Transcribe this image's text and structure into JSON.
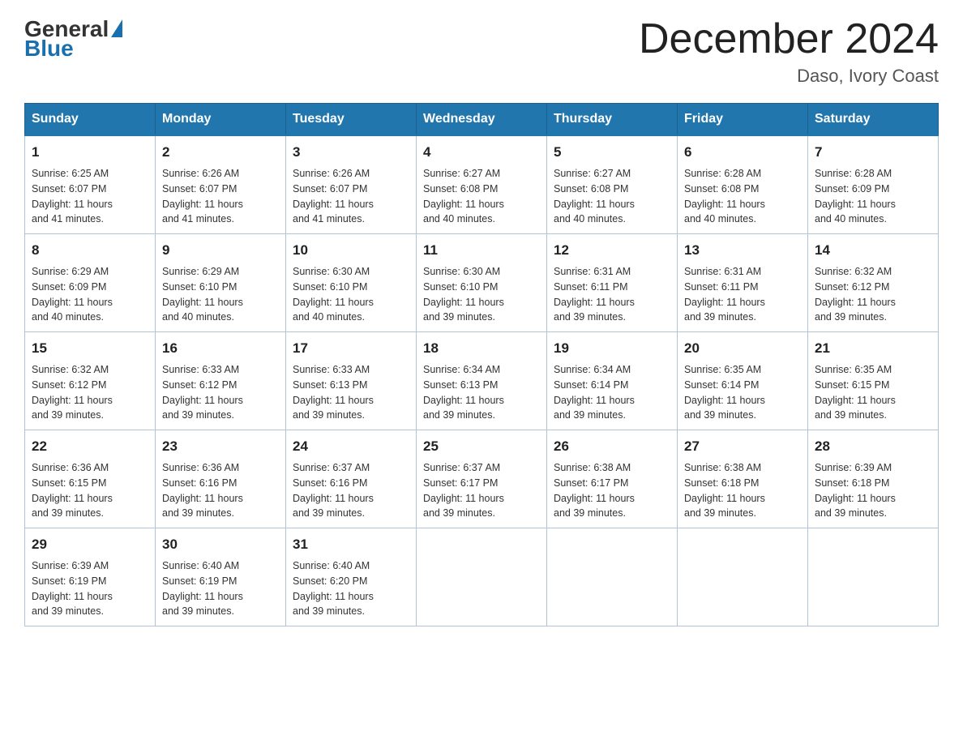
{
  "logo": {
    "general": "General",
    "blue": "Blue"
  },
  "title": "December 2024",
  "subtitle": "Daso, Ivory Coast",
  "days_header": [
    "Sunday",
    "Monday",
    "Tuesday",
    "Wednesday",
    "Thursday",
    "Friday",
    "Saturday"
  ],
  "weeks": [
    [
      {
        "day": "1",
        "sunrise": "6:25 AM",
        "sunset": "6:07 PM",
        "daylight": "11 hours and 41 minutes."
      },
      {
        "day": "2",
        "sunrise": "6:26 AM",
        "sunset": "6:07 PM",
        "daylight": "11 hours and 41 minutes."
      },
      {
        "day": "3",
        "sunrise": "6:26 AM",
        "sunset": "6:07 PM",
        "daylight": "11 hours and 41 minutes."
      },
      {
        "day": "4",
        "sunrise": "6:27 AM",
        "sunset": "6:08 PM",
        "daylight": "11 hours and 40 minutes."
      },
      {
        "day": "5",
        "sunrise": "6:27 AM",
        "sunset": "6:08 PM",
        "daylight": "11 hours and 40 minutes."
      },
      {
        "day": "6",
        "sunrise": "6:28 AM",
        "sunset": "6:08 PM",
        "daylight": "11 hours and 40 minutes."
      },
      {
        "day": "7",
        "sunrise": "6:28 AM",
        "sunset": "6:09 PM",
        "daylight": "11 hours and 40 minutes."
      }
    ],
    [
      {
        "day": "8",
        "sunrise": "6:29 AM",
        "sunset": "6:09 PM",
        "daylight": "11 hours and 40 minutes."
      },
      {
        "day": "9",
        "sunrise": "6:29 AM",
        "sunset": "6:10 PM",
        "daylight": "11 hours and 40 minutes."
      },
      {
        "day": "10",
        "sunrise": "6:30 AM",
        "sunset": "6:10 PM",
        "daylight": "11 hours and 40 minutes."
      },
      {
        "day": "11",
        "sunrise": "6:30 AM",
        "sunset": "6:10 PM",
        "daylight": "11 hours and 39 minutes."
      },
      {
        "day": "12",
        "sunrise": "6:31 AM",
        "sunset": "6:11 PM",
        "daylight": "11 hours and 39 minutes."
      },
      {
        "day": "13",
        "sunrise": "6:31 AM",
        "sunset": "6:11 PM",
        "daylight": "11 hours and 39 minutes."
      },
      {
        "day": "14",
        "sunrise": "6:32 AM",
        "sunset": "6:12 PM",
        "daylight": "11 hours and 39 minutes."
      }
    ],
    [
      {
        "day": "15",
        "sunrise": "6:32 AM",
        "sunset": "6:12 PM",
        "daylight": "11 hours and 39 minutes."
      },
      {
        "day": "16",
        "sunrise": "6:33 AM",
        "sunset": "6:12 PM",
        "daylight": "11 hours and 39 minutes."
      },
      {
        "day": "17",
        "sunrise": "6:33 AM",
        "sunset": "6:13 PM",
        "daylight": "11 hours and 39 minutes."
      },
      {
        "day": "18",
        "sunrise": "6:34 AM",
        "sunset": "6:13 PM",
        "daylight": "11 hours and 39 minutes."
      },
      {
        "day": "19",
        "sunrise": "6:34 AM",
        "sunset": "6:14 PM",
        "daylight": "11 hours and 39 minutes."
      },
      {
        "day": "20",
        "sunrise": "6:35 AM",
        "sunset": "6:14 PM",
        "daylight": "11 hours and 39 minutes."
      },
      {
        "day": "21",
        "sunrise": "6:35 AM",
        "sunset": "6:15 PM",
        "daylight": "11 hours and 39 minutes."
      }
    ],
    [
      {
        "day": "22",
        "sunrise": "6:36 AM",
        "sunset": "6:15 PM",
        "daylight": "11 hours and 39 minutes."
      },
      {
        "day": "23",
        "sunrise": "6:36 AM",
        "sunset": "6:16 PM",
        "daylight": "11 hours and 39 minutes."
      },
      {
        "day": "24",
        "sunrise": "6:37 AM",
        "sunset": "6:16 PM",
        "daylight": "11 hours and 39 minutes."
      },
      {
        "day": "25",
        "sunrise": "6:37 AM",
        "sunset": "6:17 PM",
        "daylight": "11 hours and 39 minutes."
      },
      {
        "day": "26",
        "sunrise": "6:38 AM",
        "sunset": "6:17 PM",
        "daylight": "11 hours and 39 minutes."
      },
      {
        "day": "27",
        "sunrise": "6:38 AM",
        "sunset": "6:18 PM",
        "daylight": "11 hours and 39 minutes."
      },
      {
        "day": "28",
        "sunrise": "6:39 AM",
        "sunset": "6:18 PM",
        "daylight": "11 hours and 39 minutes."
      }
    ],
    [
      {
        "day": "29",
        "sunrise": "6:39 AM",
        "sunset": "6:19 PM",
        "daylight": "11 hours and 39 minutes."
      },
      {
        "day": "30",
        "sunrise": "6:40 AM",
        "sunset": "6:19 PM",
        "daylight": "11 hours and 39 minutes."
      },
      {
        "day": "31",
        "sunrise": "6:40 AM",
        "sunset": "6:20 PM",
        "daylight": "11 hours and 39 minutes."
      },
      null,
      null,
      null,
      null
    ]
  ],
  "labels": {
    "sunrise": "Sunrise:",
    "sunset": "Sunset:",
    "daylight": "Daylight:"
  }
}
